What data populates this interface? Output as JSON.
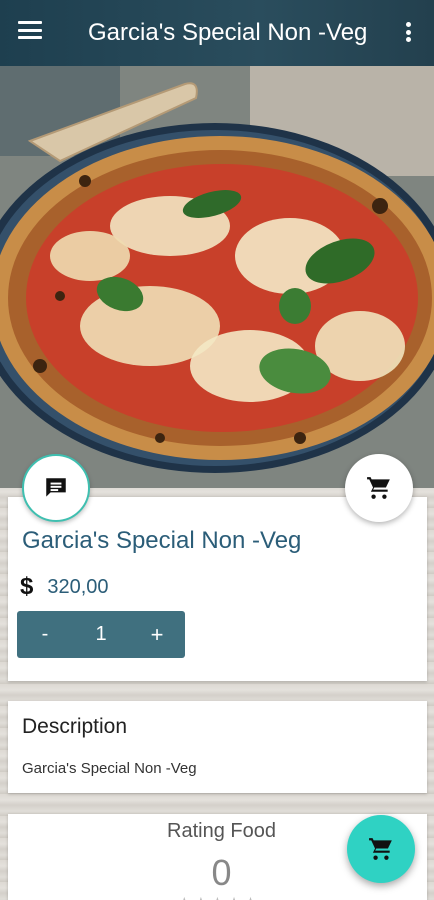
{
  "appbar": {
    "title": "Garcia's Special Non -Veg",
    "menu_icon": "hamburger-menu-icon",
    "more_icon": "more-vert-icon"
  },
  "hero": {
    "image": "pizza-photo"
  },
  "product": {
    "name": "Garcia's Special Non -Veg",
    "currency": "$",
    "price": "320,00",
    "quantity": "1",
    "minus_label": "-",
    "plus_label": "+"
  },
  "description": {
    "title": "Description",
    "text": "Garcia's Special Non -Veg"
  },
  "rating": {
    "title": "Rating Food",
    "value": "0",
    "stars": 0,
    "max_stars": 5
  },
  "colors": {
    "appbar": "#1e3f4f",
    "accent_text": "#2b5d78",
    "stepper": "#40707f",
    "fab_teal": "#2fd2c3"
  }
}
